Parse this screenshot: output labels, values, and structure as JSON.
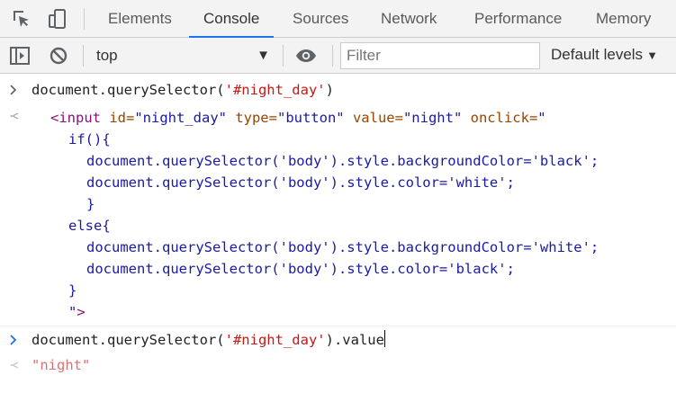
{
  "tabs": [
    {
      "label": "Elements"
    },
    {
      "label": "Console"
    },
    {
      "label": "Sources"
    },
    {
      "label": "Network"
    },
    {
      "label": "Performance"
    },
    {
      "label": "Memory"
    }
  ],
  "active_tab": "Console",
  "toolbar": {
    "context": "top",
    "filter_placeholder": "Filter",
    "levels_label": "Default levels"
  },
  "console": {
    "input1": {
      "pre": "document.querySelector(",
      "str": "'#night_day'",
      "post": ")"
    },
    "output1": {
      "tag_open": "<input",
      "attr_id": " id=",
      "val_id": "\"night_day\"",
      "attr_type": " type=",
      "val_type": "\"button\"",
      "attr_value": " value=",
      "val_value": "\"night\"",
      "attr_onclick": " onclick=",
      "val_onclick_start": "\"",
      "lines": [
        "if(){",
        "document.querySelector('body').style.backgroundColor='black';",
        "document.querySelector('body').style.color='white';",
        "}",
        "else{",
        "document.querySelector('body').style.backgroundColor='white';",
        "document.querySelector('body').style.color='black';",
        "}",
        "\"",
        ">"
      ]
    },
    "input2": {
      "pre": "document.querySelector(",
      "str": "'#night_day'",
      "post": ").value"
    },
    "output2": "\"night\""
  },
  "icons": {
    "inspect": "inspect-element-icon",
    "device": "device-toolbar-icon",
    "sidebar": "show-sidebar-icon",
    "clear": "clear-console-icon",
    "eye": "live-expression-eye-icon"
  },
  "colors": {
    "accent": "#1a73e8",
    "string": "#c41a16",
    "tag": "#881280",
    "attr_name": "#994500",
    "attr_value": "#1a1aa6"
  }
}
